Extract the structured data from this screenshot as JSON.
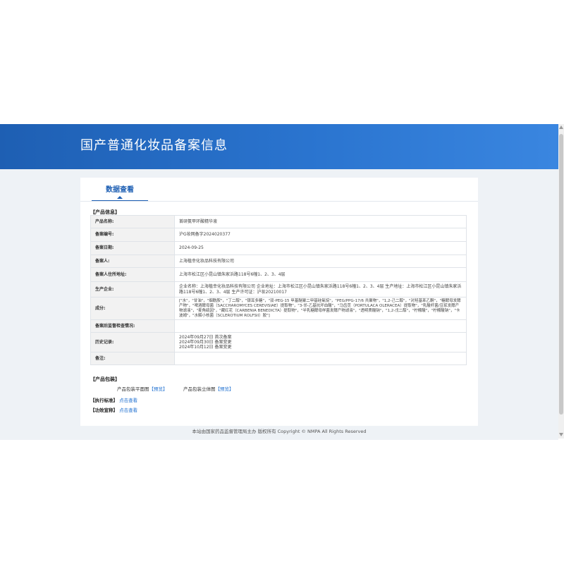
{
  "banner": {
    "title": "国产普通化妆品备案信息"
  },
  "tab": {
    "label": "数据查看"
  },
  "product_info": {
    "section_label": "【产品信息】",
    "rows": [
      {
        "label": "产品名称:",
        "value": "首研氨甲环酸精华液"
      },
      {
        "label": "备案编号:",
        "value": "沪G妆网备字2024020377"
      },
      {
        "label": "备案日期:",
        "value": "2024-09-25"
      },
      {
        "label": "备案人:",
        "value": "上海植幸化妆品科技有限公司"
      },
      {
        "label": "备案人住所地址:",
        "value": "上海市松江区小昆山镇朱家浜路118号6幢1、2、3、4层"
      },
      {
        "label": "生产企业:",
        "value": "企业名称：上海植幸化妆品科技有限公司 企业地址：上海市松江区小昆山镇朱家浜路118号6幢1、2、3、4层 生产地址：上海市松江区小昆山镇朱家浜路118号6幢1、2、3、4层 生产许可证：沪妆20210017"
      },
      {
        "label": "成分:",
        "value": "[\"水\"，\"甘油\"，\"烟酰胺\"，\"丁二醇\"，\"银耳多糖\"，\"双-PEG-15 甲基醚聚二甲基硅氧烷\"，\"PEG/PPG-17/6 共聚物\"，\"1,2-己二醇\"，\"对羟基苯乙酮\"，\"糖酵母发酵产物\"，\"啤酒酵母菌（SACCHAROMYCES CEREVISIAE）提取物\"，\"3-邻-乙基抗坏血酸\"，\"马齿苋（PORTULACA OLERACEA）提取物\"，\"乳酸杆菌/豆浆发酵产物滤液\"，\"麦角硫因\"，\"藏红花（CARBENIA BENEDICTA）提取物\"，\"半乳糖酵母样菌发酵产物滤液\"，\"透明质酸钠\"，\"1,2-戊二醇\"，\"柠檬酸\"，\"柠檬酸钠\"，\"卡波姆\"，\"水解小核菌（SCLEROTIUM ROLFSII）胶\"]"
      },
      {
        "label": "备案后监督检查情况:",
        "value": ""
      },
      {
        "label": "历史记录:",
        "value": "",
        "lines": [
          "2024年09月27日 首次备案",
          "2024年09月30日 备案变更",
          "2024年10月12日 备案变更"
        ]
      },
      {
        "label": "备注:",
        "value": ""
      }
    ]
  },
  "packaging": {
    "section_label": "【产品包装】",
    "flat_label": "产品包装平面图",
    "flat_link": "【预览】",
    "solid_label": "产品包装立体图",
    "solid_link": "【预览】"
  },
  "standard": {
    "label": "【执行标准】",
    "link": "点击查看"
  },
  "efficacy": {
    "label": "【功效宣称】",
    "link": "点击查看"
  },
  "footer": {
    "text": "本站由国家药品监督管理局主办 版权所有 Copyright © NMPA All Rights Reserved"
  },
  "colors": {
    "banner": "#2a74cf",
    "link": "#1e6fd0",
    "background": "#eef2f6"
  }
}
